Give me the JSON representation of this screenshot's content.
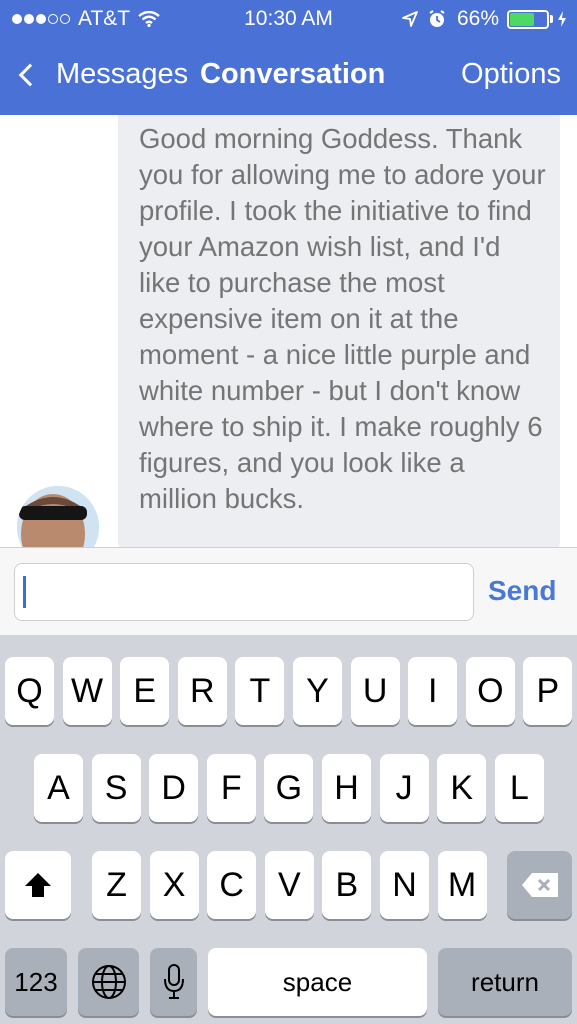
{
  "status_bar": {
    "carrier": "AT&T",
    "time": "10:30 AM",
    "battery_percent": "66%",
    "battery_level": 0.66,
    "signal_bars": 3,
    "signal_total": 5
  },
  "nav": {
    "back_label": "Messages",
    "title": "Conversation",
    "options_label": "Options"
  },
  "message": {
    "text": "Good morning Goddess. Thank you for allowing me to adore your profile. I took the initiative to find your Amazon wish list, and I'd like to purchase the most expensive item on it at the moment - a nice little purple and white number - but I don't know where to ship it. I make roughly 6 figures, and you look like a million bucks."
  },
  "input": {
    "value": "",
    "send_label": "Send"
  },
  "keyboard": {
    "row1": [
      "Q",
      "W",
      "E",
      "R",
      "T",
      "Y",
      "U",
      "I",
      "O",
      "P"
    ],
    "row2": [
      "A",
      "S",
      "D",
      "F",
      "G",
      "H",
      "J",
      "K",
      "L"
    ],
    "row3": [
      "Z",
      "X",
      "C",
      "V",
      "B",
      "N",
      "M"
    ],
    "numbers_label": "123",
    "space_label": "space",
    "return_label": "return"
  },
  "colors": {
    "header": "#4a72d6",
    "accent": "#4a78d6",
    "bubble": "#eceef2",
    "keyboard_bg": "#d1d5db"
  }
}
